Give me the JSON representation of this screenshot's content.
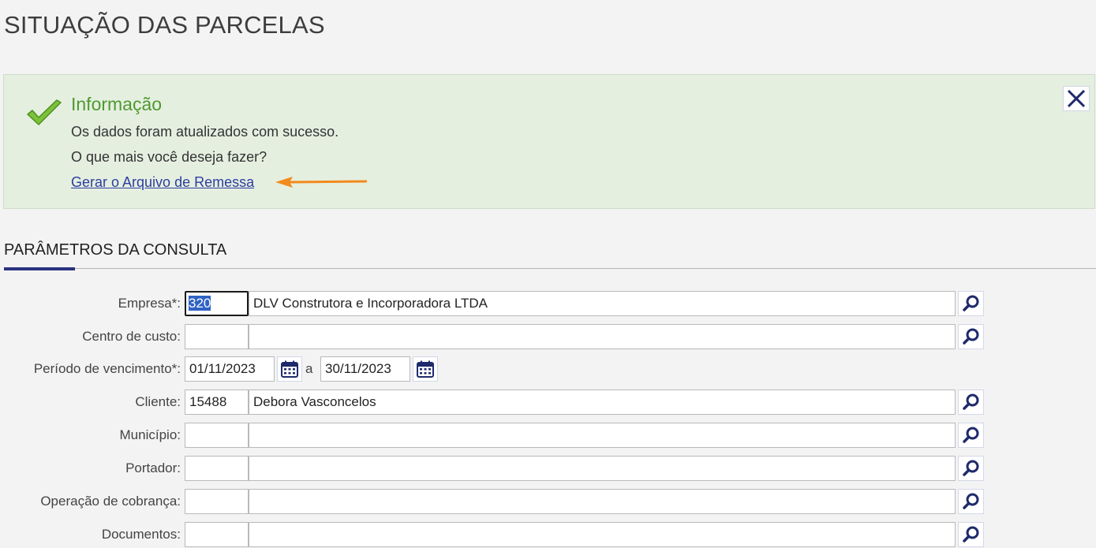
{
  "page": {
    "title": "SITUAÇÃO DAS PARCELAS"
  },
  "info": {
    "title": "Informação",
    "message": "Os dados foram atualizados com sucesso.",
    "question": "O que mais você deseja fazer?",
    "link": "Gerar o Arquivo de Remessa",
    "annotation_color": "#f28a1c"
  },
  "section": {
    "title": "PARÂMETROS DA CONSULTA",
    "accent_color": "#2b3280"
  },
  "form": {
    "empresa": {
      "label": "Empresa*:",
      "code": "320",
      "desc": "DLV Construtora e Incorporadora LTDA"
    },
    "centro": {
      "label": "Centro de custo:",
      "code": "",
      "desc": ""
    },
    "periodo": {
      "label": "Período de vencimento*:",
      "start": "01/11/2023",
      "sep": "a",
      "end": "30/11/2023"
    },
    "cliente": {
      "label": "Cliente:",
      "code": "15488",
      "desc": "Debora Vasconcelos"
    },
    "municipio": {
      "label": "Município:",
      "code": "",
      "desc": ""
    },
    "portador": {
      "label": "Portador:",
      "code": "",
      "desc": ""
    },
    "operacao": {
      "label": "Operação de cobrança:",
      "code": "",
      "desc": ""
    },
    "documentos": {
      "label": "Documentos:",
      "code": "",
      "desc": ""
    }
  },
  "icons": {
    "check": "check-icon",
    "close": "close-icon",
    "search": "search-icon",
    "calendar": "calendar-icon"
  }
}
